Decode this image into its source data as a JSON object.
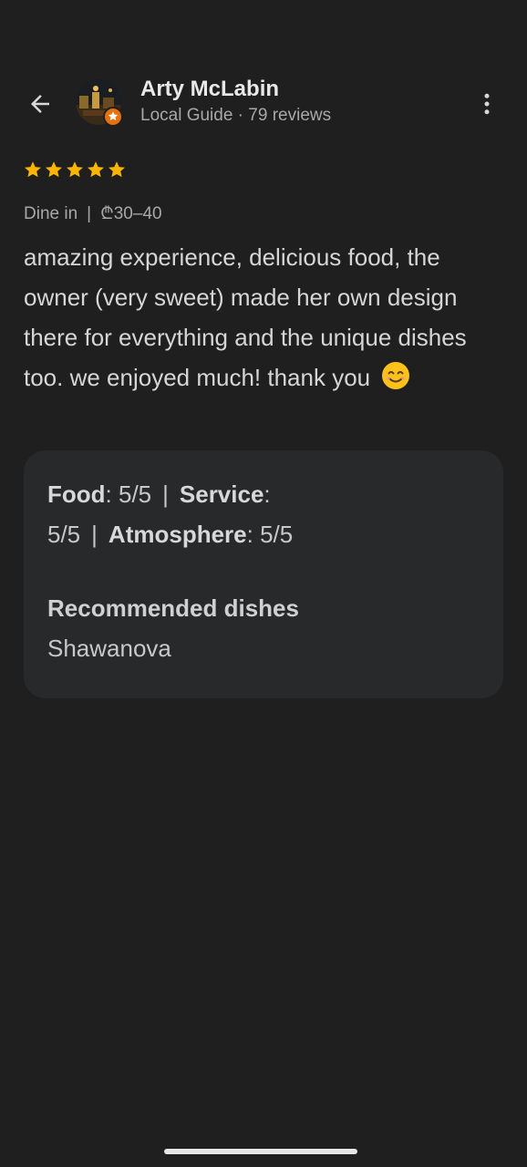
{
  "header": {
    "back_icon": "arrow-back-icon",
    "reviewer_name": "Arty McLabin",
    "reviewer_subtitle": "Local Guide · 79 reviews",
    "more_icon": "more-vert-icon"
  },
  "review": {
    "rating": 5,
    "rating_max": 5,
    "star_color": "#f9b500",
    "meta_service": "Dine in",
    "meta_separator": "|",
    "meta_price": "₾30–40",
    "text": "amazing experience, delicious food, the owner (very sweet) made her own design there for everything and the unique dishes too. we enjoyed much! thank you",
    "emoji": "smiling-face-emoji"
  },
  "details": {
    "food_label": "Food",
    "food_value": ": 5/5",
    "service_label": "Service",
    "service_value": ":",
    "service_score": "5/5",
    "atmosphere_label": "Atmosphere",
    "atmosphere_value": ": 5/5",
    "separator": "|",
    "recommended_title": "Recommended dishes",
    "recommended_value": "Shawanova"
  },
  "colors": {
    "background": "#1f1f1f",
    "card": "#28292b",
    "badge": "#e8710a"
  }
}
